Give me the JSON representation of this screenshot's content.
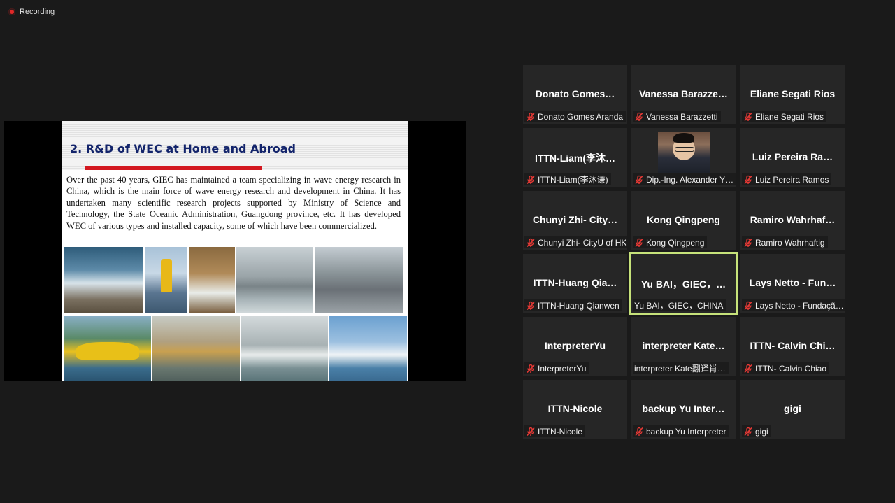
{
  "recording": {
    "label": "Recording",
    "color": "#e02828"
  },
  "slide": {
    "title": "2. R&D of WEC at Home and Abroad",
    "body": "Over the past 40 years, GIEC has maintained a team specializing in wave energy research in China, which is the main force of wave energy research and development in China. It has undertaken many scientific research projects supported by Ministry of Science and Technology, the State Oceanic Administration, Guangdong province, etc. It has developed WEC of various types and installed capacity, some of which have been commercialized."
  },
  "participants": [
    {
      "name": "Donato  Gomes…",
      "label": "Donato Gomes Aranda",
      "muted": true
    },
    {
      "name": "Vanessa  Barazze…",
      "label": "Vanessa Barazzetti",
      "muted": true
    },
    {
      "name": "Eliane Segati Rios",
      "label": "Eliane Segati Rios",
      "muted": true
    },
    {
      "name": "ITTN-Liam(李沐…",
      "label": "ITTN-Liam(李沐谦)",
      "muted": true
    },
    {
      "name": "",
      "label": "Dip.-Ing. Alexander Y…",
      "muted": true,
      "video": true
    },
    {
      "name": "Luiz Pereira  Ra…",
      "label": "Luiz Pereira Ramos",
      "muted": true
    },
    {
      "name": "Chunyi  Zhi-  City…",
      "label": "Chunyi Zhi- CityU of HK",
      "muted": true
    },
    {
      "name": "Kong Qingpeng",
      "label": "Kong Qingpeng",
      "muted": true
    },
    {
      "name": "Ramiro  Wahrhaf…",
      "label": "Ramiro Wahrhaftig",
      "muted": true
    },
    {
      "name": "ITTN-Huang  Qia…",
      "label": "ITTN-Huang Qianwen",
      "muted": true
    },
    {
      "name": "Yu BAI，GIEC，…",
      "label": "Yu BAI，GIEC，CHINA",
      "muted": false,
      "speaking": true
    },
    {
      "name": "Lays Netto - Fun…",
      "label": "Lays Netto - Fundaçã…",
      "muted": true
    },
    {
      "name": "InterpreterYu",
      "label": "InterpreterYu",
      "muted": true
    },
    {
      "name": "interpreter  Kate…",
      "label": "interpreter Kate翻译肖…",
      "muted": false
    },
    {
      "name": "ITTN-  Calvin  Chi…",
      "label": "ITTN- Calvin Chiao",
      "muted": true
    },
    {
      "name": "ITTN-Nicole",
      "label": "ITTN-Nicole",
      "muted": true
    },
    {
      "name": "backup  Yu  Inter…",
      "label": "backup Yu Interpreter",
      "muted": true
    },
    {
      "name": "gigi",
      "label": "gigi",
      "muted": true
    }
  ],
  "icons": {
    "muted_mic": "mic-muted-icon",
    "mute_color": "#e53935",
    "speaking_border": "#c6e27a"
  }
}
